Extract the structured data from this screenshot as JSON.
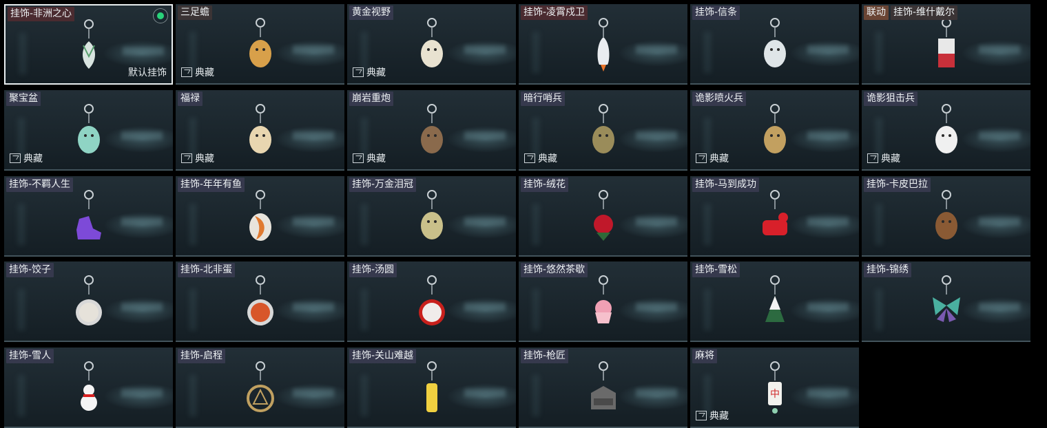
{
  "labels": {
    "rarity": "典藏",
    "default": "默认挂饰",
    "collab": "联动"
  },
  "items": [
    {
      "name": "挂饰-非洲之心",
      "charm_icon": "heart-hook-icon",
      "charm_color": "#d9e4e0",
      "tag_style": "red",
      "selected": true,
      "equipped": true,
      "rarity": false,
      "is_default": true,
      "collab": false
    },
    {
      "name": "三足蟾",
      "charm_icon": "golden-toad-icon",
      "charm_color": "#d8a04a",
      "tag_style": "brown",
      "selected": false,
      "equipped": false,
      "rarity": true,
      "is_default": false,
      "collab": false
    },
    {
      "name": "黄金视野",
      "charm_icon": "cat-sentry-icon",
      "charm_color": "#e8e2d0",
      "tag_style": "",
      "selected": false,
      "equipped": false,
      "rarity": true,
      "is_default": false,
      "collab": false
    },
    {
      "name": "挂饰-凌霄戍卫",
      "charm_icon": "rocket-icon",
      "charm_color": "#e9ecf0",
      "tag_style": "red",
      "selected": false,
      "equipped": false,
      "rarity": false,
      "is_default": false,
      "collab": false
    },
    {
      "name": "挂饰-信条",
      "charm_icon": "cup-icon",
      "charm_color": "#dfe5e8",
      "tag_style": "",
      "selected": false,
      "equipped": false,
      "rarity": false,
      "is_default": false,
      "collab": false
    },
    {
      "name": "挂饰-维什戴尔",
      "charm_icon": "red-box-icon",
      "charm_color": "#c8303a",
      "tag_style": "brown",
      "selected": false,
      "equipped": false,
      "rarity": false,
      "is_default": false,
      "collab": true
    },
    {
      "name": "聚宝盆",
      "charm_icon": "treasure-bowl-icon",
      "charm_color": "#8fd4c4",
      "tag_style": "",
      "selected": false,
      "equipped": false,
      "rarity": true,
      "is_default": false,
      "collab": false
    },
    {
      "name": "福禄",
      "charm_icon": "gourd-icon",
      "charm_color": "#e8d6b0",
      "tag_style": "",
      "selected": false,
      "equipped": false,
      "rarity": true,
      "is_default": false,
      "collab": false
    },
    {
      "name": "崩岩重炮",
      "charm_icon": "brown-figure-icon",
      "charm_color": "#8a6a4c",
      "tag_style": "",
      "selected": false,
      "equipped": false,
      "rarity": true,
      "is_default": false,
      "collab": false
    },
    {
      "name": "暗行哨兵",
      "charm_icon": "olive-figure-icon",
      "charm_color": "#9a8c5a",
      "tag_style": "",
      "selected": false,
      "equipped": false,
      "rarity": true,
      "is_default": false,
      "collab": false
    },
    {
      "name": "诡影喷火兵",
      "charm_icon": "flamethrower-figure-icon",
      "charm_color": "#c2a060",
      "tag_style": "",
      "selected": false,
      "equipped": false,
      "rarity": true,
      "is_default": false,
      "collab": false
    },
    {
      "name": "诡影狙击兵",
      "charm_icon": "white-bird-icon",
      "charm_color": "#f0f0f0",
      "tag_style": "",
      "selected": false,
      "equipped": false,
      "rarity": true,
      "is_default": false,
      "collab": false
    },
    {
      "name": "挂饰-不羁人生",
      "charm_icon": "sneaker-icon",
      "charm_color": "#7d4ad8",
      "tag_style": "",
      "selected": false,
      "equipped": false,
      "rarity": false,
      "is_default": false,
      "collab": false
    },
    {
      "name": "挂饰-年年有鱼",
      "charm_icon": "fish-icon",
      "charm_color": "#e07a30",
      "tag_style": "",
      "selected": false,
      "equipped": false,
      "rarity": false,
      "is_default": false,
      "collab": false
    },
    {
      "name": "挂饰-万金泪冠",
      "charm_icon": "gold-ball-icon",
      "charm_color": "#c9c08a",
      "tag_style": "",
      "selected": false,
      "equipped": false,
      "rarity": false,
      "is_default": false,
      "collab": false
    },
    {
      "name": "挂饰-绒花",
      "charm_icon": "rose-icon",
      "charm_color": "#c0182a",
      "tag_style": "",
      "selected": false,
      "equipped": false,
      "rarity": false,
      "is_default": false,
      "collab": false
    },
    {
      "name": "挂饰-马到成功",
      "charm_icon": "red-horse-icon",
      "charm_color": "#d8202a",
      "tag_style": "",
      "selected": false,
      "equipped": false,
      "rarity": false,
      "is_default": false,
      "collab": false
    },
    {
      "name": "挂饰-卡皮巴拉",
      "charm_icon": "capybara-icon",
      "charm_color": "#8a5a34",
      "tag_style": "",
      "selected": false,
      "equipped": false,
      "rarity": false,
      "is_default": false,
      "collab": false
    },
    {
      "name": "挂饰-饺子",
      "charm_icon": "dumpling-plate-icon",
      "charm_color": "#e6e2da",
      "tag_style": "",
      "selected": false,
      "equipped": false,
      "rarity": false,
      "is_default": false,
      "collab": false
    },
    {
      "name": "挂饰-北非蛋",
      "charm_icon": "shakshuka-icon",
      "charm_color": "#d8562a",
      "tag_style": "",
      "selected": false,
      "equipped": false,
      "rarity": false,
      "is_default": false,
      "collab": false
    },
    {
      "name": "挂饰-汤圆",
      "charm_icon": "tangyuan-bowl-icon",
      "charm_color": "#c8201c",
      "tag_style": "",
      "selected": false,
      "equipped": false,
      "rarity": false,
      "is_default": false,
      "collab": false
    },
    {
      "name": "挂饰-悠然茶歇",
      "charm_icon": "cupcake-icon",
      "charm_color": "#f0a0b4",
      "tag_style": "",
      "selected": false,
      "equipped": false,
      "rarity": false,
      "is_default": false,
      "collab": false
    },
    {
      "name": "挂饰-雪松",
      "charm_icon": "pine-tree-icon",
      "charm_color": "#2c6a40",
      "tag_style": "",
      "selected": false,
      "equipped": false,
      "rarity": false,
      "is_default": false,
      "collab": false
    },
    {
      "name": "挂饰-锦绣",
      "charm_icon": "butterfly-icon",
      "charm_color": "#4ab0a0",
      "tag_style": "",
      "selected": false,
      "equipped": false,
      "rarity": false,
      "is_default": false,
      "collab": false
    },
    {
      "name": "挂饰-雪人",
      "charm_icon": "snowman-icon",
      "charm_color": "#f4f4f4",
      "tag_style": "",
      "selected": false,
      "equipped": false,
      "rarity": false,
      "is_default": false,
      "collab": false
    },
    {
      "name": "挂饰-启程",
      "charm_icon": "medallion-icon",
      "charm_color": "#c0a060",
      "tag_style": "",
      "selected": false,
      "equipped": false,
      "rarity": false,
      "is_default": false,
      "collab": false
    },
    {
      "name": "挂饰-关山难越",
      "charm_icon": "gold-bar-icon",
      "charm_color": "#f0d040",
      "tag_style": "",
      "selected": false,
      "equipped": false,
      "rarity": false,
      "is_default": false,
      "collab": false
    },
    {
      "name": "挂饰-枪匠",
      "charm_icon": "workbench-icon",
      "charm_color": "#6a6a6a",
      "tag_style": "",
      "selected": false,
      "equipped": false,
      "rarity": false,
      "is_default": false,
      "collab": false
    },
    {
      "name": "麻将",
      "charm_icon": "mahjong-tile-icon",
      "charm_color": "#f2f2ee",
      "tag_style": "",
      "selected": false,
      "equipped": false,
      "rarity": true,
      "is_default": false,
      "collab": false
    }
  ]
}
